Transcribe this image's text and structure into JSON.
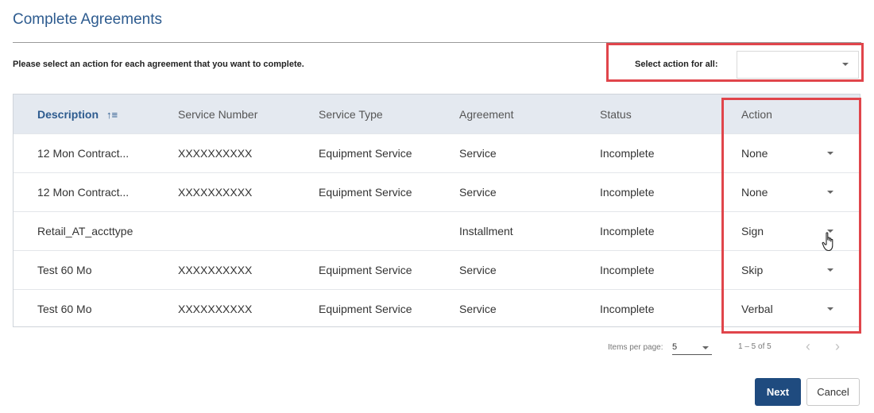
{
  "page": {
    "title": "Complete Agreements",
    "instructions": "Please select an action for each agreement that you want to complete."
  },
  "select_all": {
    "label": "Select action for all:",
    "value": ""
  },
  "table": {
    "columns": [
      "Description",
      "Service Number",
      "Service Type",
      "Agreement",
      "Status",
      "Action"
    ],
    "sort_icon": "sort-ascending-icon",
    "rows": [
      {
        "description": "12 Mon Contract...",
        "service_number": "XXXXXXXXXX",
        "service_type": "Equipment Service",
        "agreement": "Service",
        "status": "Incomplete",
        "action": "None"
      },
      {
        "description": "12 Mon Contract...",
        "service_number": "XXXXXXXXXX",
        "service_type": "Equipment Service",
        "agreement": "Service",
        "status": "Incomplete",
        "action": "None"
      },
      {
        "description": "Retail_AT_accttype",
        "service_number": "",
        "service_type": "",
        "agreement": "Installment",
        "status": "Incomplete",
        "action": "Sign"
      },
      {
        "description": "Test 60 Mo",
        "service_number": "XXXXXXXXXX",
        "service_type": "Equipment Service",
        "agreement": "Service",
        "status": "Incomplete",
        "action": "Skip"
      },
      {
        "description": "Test 60 Mo",
        "service_number": "XXXXXXXXXX",
        "service_type": "Equipment Service",
        "agreement": "Service",
        "status": "Incomplete",
        "action": "Verbal"
      }
    ]
  },
  "pagination": {
    "items_per_page_label": "Items per page:",
    "items_per_page": "5",
    "range": "1 – 5 of 5"
  },
  "buttons": {
    "next": "Next",
    "cancel": "Cancel"
  },
  "colors": {
    "title": "#2d5b8f",
    "header_bg": "#e4e9f0",
    "highlight": "#e0454b",
    "primary_button": "#1f4b7f"
  }
}
